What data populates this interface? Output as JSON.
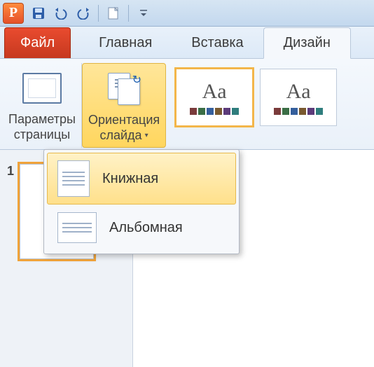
{
  "qat": {
    "save_title": "Сохранить",
    "undo_title": "Отменить",
    "redo_title": "Повторить",
    "new_title": "Создать",
    "customize_title": "Настроить"
  },
  "tabs": {
    "file": "Файл",
    "home": "Главная",
    "insert": "Вставка",
    "design": "Дизайн"
  },
  "ribbon": {
    "page_setup": {
      "line1": "Параметры",
      "line2": "страницы"
    },
    "orientation": {
      "line1": "Ориентация",
      "line2": "слайда"
    },
    "theme_label": "Aa"
  },
  "orientation_menu": {
    "portrait": "Книжная",
    "landscape": "Альбомная"
  },
  "slide_panel": {
    "current_index": "1",
    "close_title": "Закрыть"
  },
  "theme_swatches": [
    "#7a3b3b",
    "#3b6e46",
    "#355f9c",
    "#7a5a30",
    "#5c3b7a",
    "#2f7d7d"
  ]
}
